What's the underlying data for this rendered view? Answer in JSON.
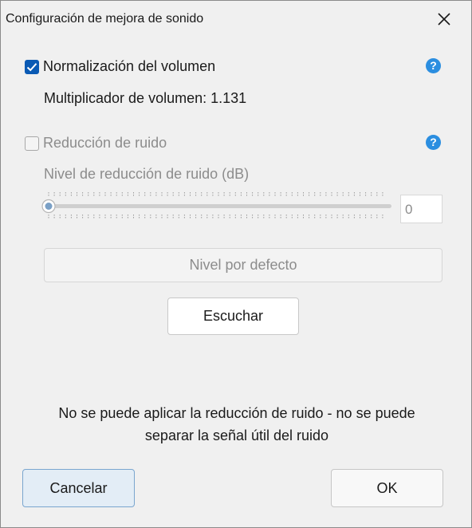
{
  "window": {
    "title": "Configuración de mejora de sonido",
    "close_icon": "close-icon"
  },
  "normalization": {
    "label": "Normalización del volumen",
    "checked": true,
    "multiplier_text": "Multiplicador de volumen: 1.131",
    "help_glyph": "?"
  },
  "noise_reduction": {
    "label": "Reducción de ruido",
    "checked": false,
    "enabled": false,
    "help_glyph": "?",
    "level_label": "Nivel de reducción de ruido (dB)",
    "slider_value": 0,
    "value_text": "0",
    "default_button_label": "Nivel por defecto"
  },
  "listen_button_label": "Escuchar",
  "message": {
    "line1": "No se puede aplicar la reducción de ruido - no se puede",
    "line2": "separar la señal útil del ruido"
  },
  "footer": {
    "cancel_label": "Cancelar",
    "ok_label": "OK"
  },
  "colors": {
    "accent": "#0a5ab4",
    "help": "#2b8ee0",
    "disabled_text": "#8c8c8c",
    "cancel_focus_border": "#7aa6cf"
  }
}
